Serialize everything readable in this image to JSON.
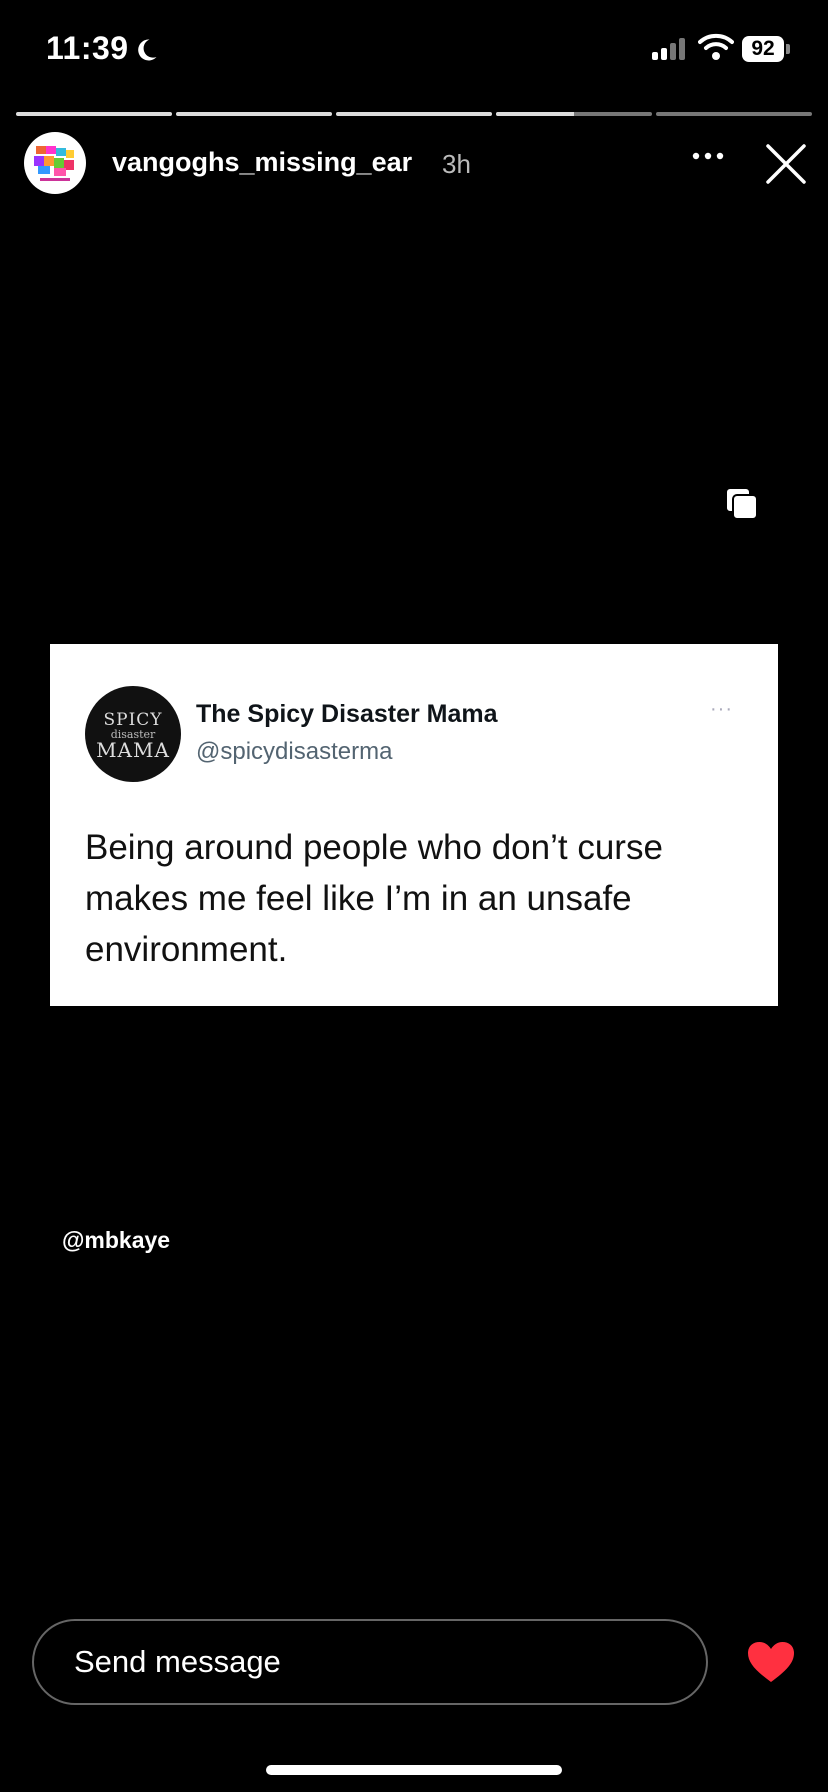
{
  "status_bar": {
    "time": "11:39",
    "battery": "92"
  },
  "story": {
    "segments_progress": [
      1,
      1,
      1,
      0.5,
      0
    ],
    "username": "vangoghs_missing_ear",
    "time_ago": "3h",
    "mention": "@mbkaye"
  },
  "tweet": {
    "avatar_text": {
      "line1": "SPICY",
      "line2": "disaster",
      "line3": "MAMA"
    },
    "name": "The Spicy Disaster Mama",
    "handle": "@spicydisasterma",
    "more": "···",
    "text": "Being around people who don’t curse makes me feel like I’m in an unsafe environment."
  },
  "footer": {
    "message_placeholder": "Send message"
  },
  "colors": {
    "heart": "#ff3040",
    "background": "#000000"
  },
  "icons": [
    "moon-icon",
    "signal-icon",
    "wifi-icon",
    "more-icon",
    "close-icon",
    "copy-icon",
    "heart-icon"
  ]
}
